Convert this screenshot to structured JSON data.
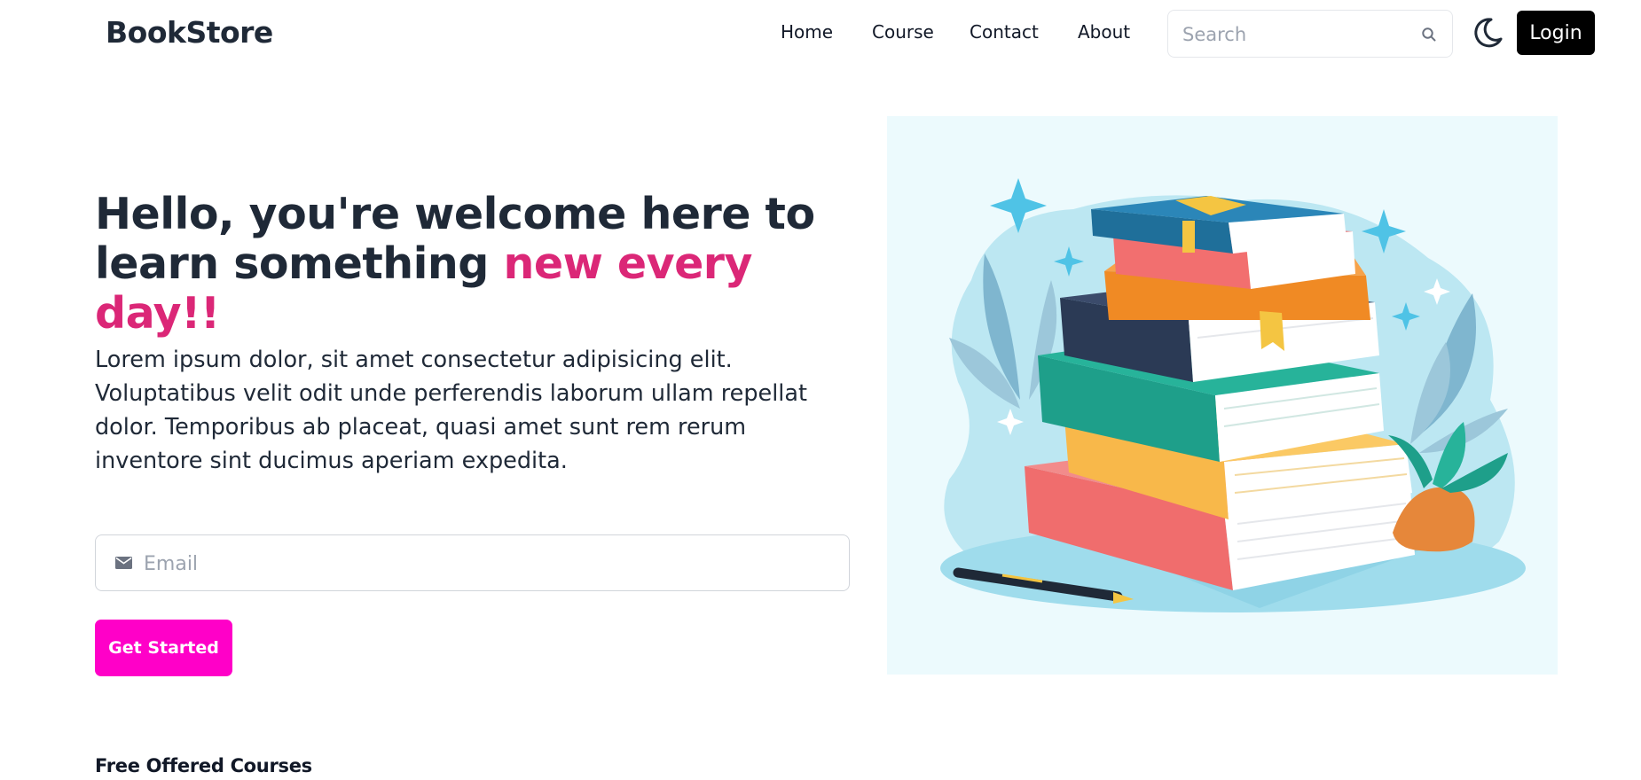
{
  "navbar": {
    "brand": "BookStore",
    "links": [
      "Home",
      "Course",
      "Contact",
      "About"
    ],
    "search_placeholder": "Search",
    "login_label": "Login"
  },
  "hero": {
    "title_main": "Hello, you're welcome here to learn something ",
    "title_accent": "new every day!!",
    "description": "Lorem ipsum dolor, sit amet consectetur adipisicing elit. Voluptatibus velit odit unde perferendis laborum ullam repellat dolor. Temporibus ab placeat, quasi amet sunt rem rerum inventore sint ducimus aperiam expedita.",
    "email_placeholder": "Email",
    "cta_label": "Get Started"
  },
  "courses": {
    "section_title": "Free Offered Courses"
  },
  "colors": {
    "accent_text": "#db2777",
    "cta_background": "#ff00c8",
    "login_background": "#000000",
    "illustration_background": "#ecfafd"
  },
  "icons": {
    "search": "search-icon",
    "theme": "moon-icon",
    "email": "mail-icon"
  }
}
